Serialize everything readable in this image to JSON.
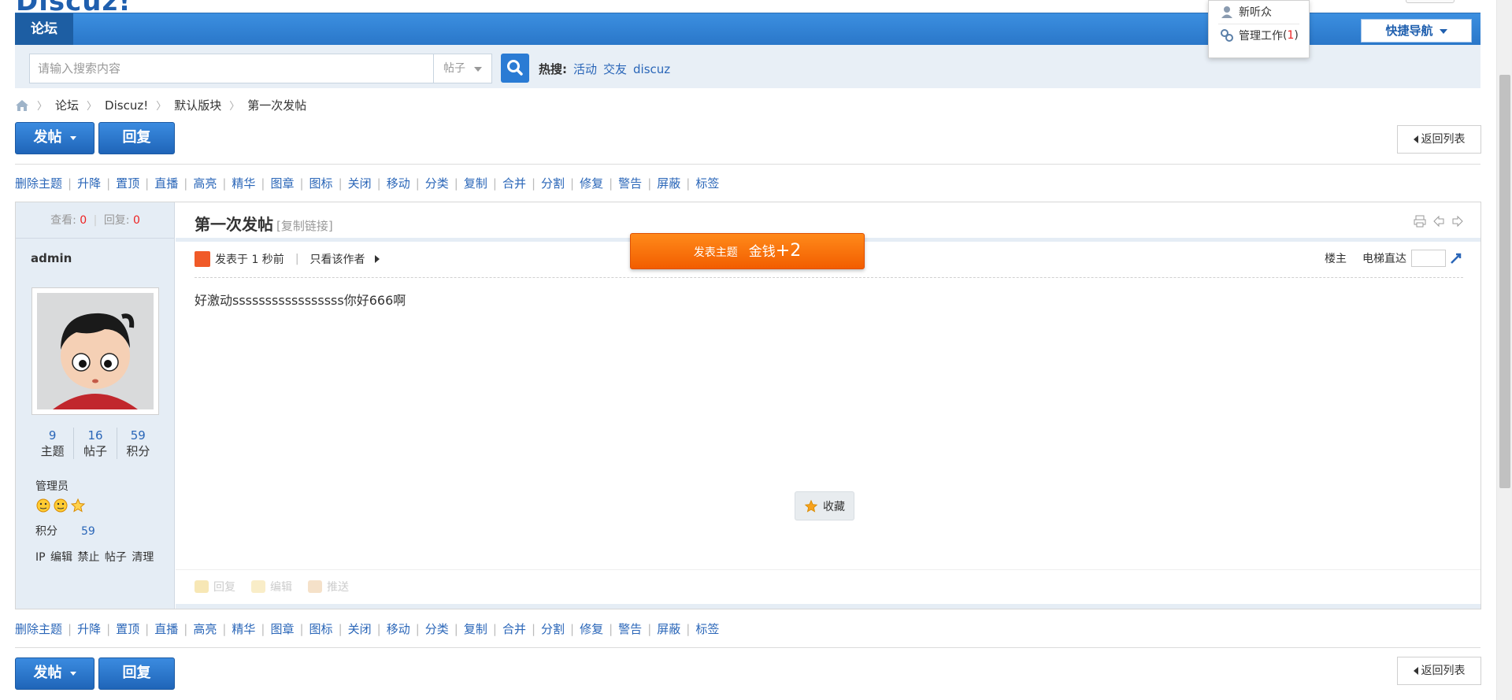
{
  "header": {
    "logo_text": "Discuz!",
    "nav_forum": "论坛",
    "quick_nav": "快捷导航",
    "user_menu": {
      "item1": "新听众",
      "item2_label": "管理工作",
      "item2_open": "(",
      "item2_count": "1",
      "item2_close": ")"
    }
  },
  "search": {
    "placeholder": "请输入搜索内容",
    "type": "帖子",
    "hot_label": "热搜:",
    "hot_terms": [
      "活动",
      "交友",
      "discuz"
    ]
  },
  "breadcrumb": [
    "论坛",
    "Discuz!",
    "默认版块",
    "第一次发帖"
  ],
  "actions": {
    "post": "发帖",
    "reply": "回复",
    "back_to_list": "返回列表"
  },
  "mod_tools": [
    "删除主题",
    "升降",
    "置顶",
    "直播",
    "高亮",
    "精华",
    "图章",
    "图标",
    "关闭",
    "移动",
    "分类",
    "复制",
    "合并",
    "分割",
    "修复",
    "警告",
    "屏蔽",
    "标签"
  ],
  "thread": {
    "views_label": "查看:",
    "views": "0",
    "replies_label": "回复:",
    "replies": "0",
    "title": "第一次发帖",
    "copy_link": "[复制链接]",
    "posted": "发表于 1 秒前",
    "only_author": "只看该作者",
    "floor": "楼主",
    "elevator": "电梯直达",
    "body": "好激动sssssssssssssssss你好666啊",
    "favorite": "收藏",
    "post_actions": [
      "回复",
      "编辑",
      "推送"
    ]
  },
  "author": {
    "name": "admin",
    "stats": [
      {
        "value": "9",
        "label": "主题"
      },
      {
        "value": "16",
        "label": "帖子"
      },
      {
        "value": "59",
        "label": "积分"
      }
    ],
    "group": "管理员",
    "points_label": "积分",
    "points": "59",
    "admin_links": "IP 编辑 禁止 帖子 清理"
  },
  "toast": {
    "label": "发表主题",
    "reward": "金钱",
    "amount": "+2"
  },
  "colors": {
    "brand_blue": "#2a77c9",
    "link_blue": "#2a66b8",
    "toast_orange": "#f25d00",
    "count_red": "#e22222"
  }
}
